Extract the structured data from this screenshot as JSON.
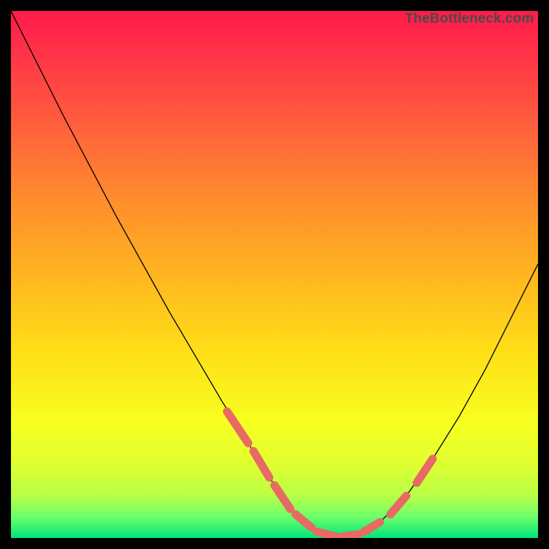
{
  "watermark": "TheBottleneck.com",
  "chart_data": {
    "type": "line",
    "title": "",
    "xlabel": "",
    "ylabel": "",
    "xlim": [
      0,
      100
    ],
    "ylim": [
      0,
      100
    ],
    "grid": false,
    "legend": false,
    "series": [
      {
        "name": "bottleneck-curve",
        "x": [
          0,
          5,
          10,
          15,
          20,
          25,
          30,
          35,
          40,
          45,
          50,
          52,
          54,
          56,
          58,
          60,
          62,
          65,
          70,
          75,
          80,
          85,
          90,
          95,
          100
        ],
        "y": [
          100,
          90,
          80,
          70.5,
          61,
          52,
          43,
          34.5,
          26,
          18,
          10,
          7,
          4.5,
          2.5,
          1.2,
          0.5,
          0.2,
          0.5,
          3,
          8,
          15,
          23,
          32,
          42,
          52
        ],
        "color": "#000000"
      }
    ],
    "markers": {
      "name": "highlighted-range",
      "color": "#e86a64",
      "segments": [
        {
          "x": [
            41,
            45
          ],
          "y": [
            24,
            18
          ]
        },
        {
          "x": [
            46,
            49
          ],
          "y": [
            16.5,
            11.5
          ]
        },
        {
          "x": [
            50,
            53
          ],
          "y": [
            10,
            5.5
          ]
        },
        {
          "x": [
            54,
            57
          ],
          "y": [
            4.5,
            2
          ]
        },
        {
          "x": [
            58,
            62
          ],
          "y": [
            1.2,
            0.2
          ]
        },
        {
          "x": [
            63,
            66
          ],
          "y": [
            0.3,
            0.7
          ]
        },
        {
          "x": [
            67,
            70
          ],
          "y": [
            1.2,
            3
          ]
        },
        {
          "x": [
            72,
            75
          ],
          "y": [
            4.5,
            8
          ]
        },
        {
          "x": [
            77,
            80
          ],
          "y": [
            10.5,
            15
          ]
        }
      ]
    }
  }
}
